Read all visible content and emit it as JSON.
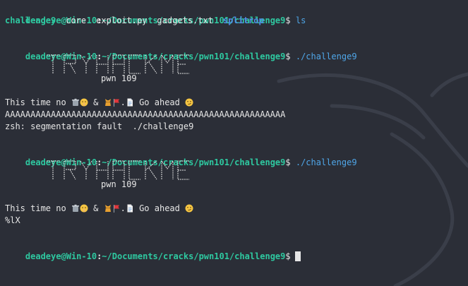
{
  "prompt": {
    "user_host": "deadeye@Win-10",
    "colon": ":",
    "path": "~/Documents/cracks/pwn101/challenge9",
    "sign": "$"
  },
  "commands": {
    "ls": "ls",
    "run1": "./challenge9",
    "run2": "./challenge9"
  },
  "ls_output": {
    "dir": "challenge9",
    "core": "core",
    "exploit": "exploit.py",
    "gadgets": "gadgets.txt",
    "splitrop": "splitrop"
  },
  "banner": {
    "logo_text": "TRYHACKME",
    "subtitle": "pwn 109"
  },
  "run1": {
    "msg_start": "This time no ",
    "msg_amp": " & ",
    "msg_dot": ".",
    "msg_end": " Go ahead ",
    "input": "AAAAAAAAAAAAAAAAAAAAAAAAAAAAAAAAAAAAAAAAAAAAAAAAAAAAAAA",
    "segfault": "zsh: segmentation fault  ./challenge9"
  },
  "run2": {
    "msg_start": "This time no ",
    "msg_amp": " & ",
    "msg_dot": ".",
    "msg_end": " Go ahead ",
    "input": "%lX"
  },
  "icons": {
    "trash": "trash-icon",
    "shush": "shushing-face-icon",
    "cat": "cat-icon",
    "flag": "red-flag-icon",
    "doc": "document-icon",
    "smirk": "smirking-face-icon"
  },
  "colors": {
    "background": "#2b2e37",
    "prompt": "#2ec8a0",
    "command": "#4fa6e8",
    "text": "#e6e6e6"
  }
}
